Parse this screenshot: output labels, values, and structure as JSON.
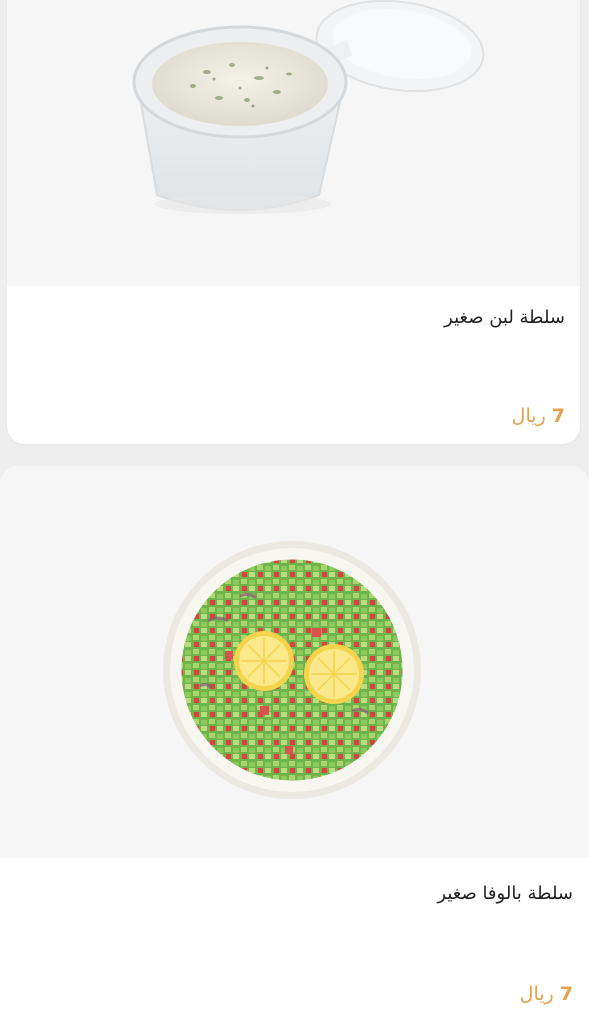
{
  "products": [
    {
      "title": "سلطة لبن صغير",
      "price_amount": "7",
      "currency": "ريال",
      "image": "laban-salad-cup-image"
    },
    {
      "title": "سلطة بالوفا صغير",
      "price_amount": "7",
      "currency": "ريال",
      "image": "balofa-salad-bowl-image"
    }
  ],
  "colors": {
    "price": "#e3a24b",
    "card_background": "#ffffff",
    "image_background": "#f6f6f6",
    "page_background": "#eeeeee"
  }
}
